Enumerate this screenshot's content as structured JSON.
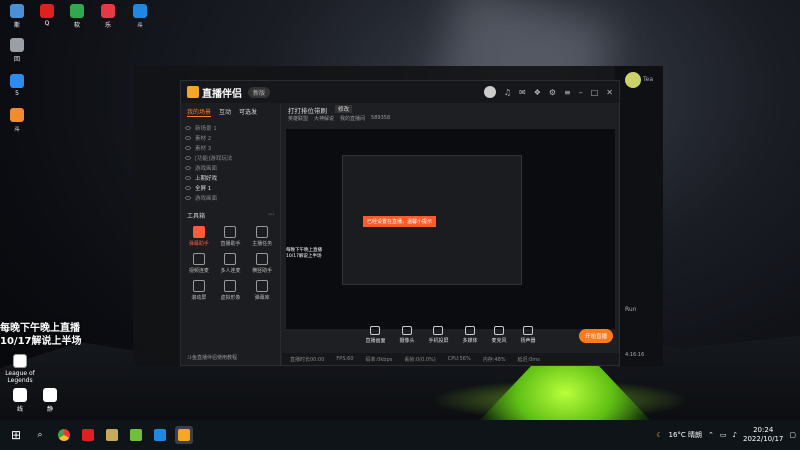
{
  "desktop": {
    "icons": [
      {
        "label": "斯",
        "color": "#4a90d9"
      },
      {
        "label": "Q",
        "color": "#e02020"
      },
      {
        "label": "软",
        "color": "#2fa84f"
      },
      {
        "label": "乐",
        "color": "#e63946"
      },
      {
        "label": "斗",
        "color": "#1e88e5"
      },
      {
        "label": "回",
        "color": "#9aa0a6"
      },
      {
        "label": "5",
        "color": "#2d8cf0"
      },
      {
        "label": "斗",
        "color": "#f08c2d"
      }
    ],
    "notice_text": "每晚下午晚上直播\n10/17解说上半场",
    "lol_label": "League of Legends",
    "bottom_icons": [
      "线",
      "静"
    ]
  },
  "backwin": {
    "right_labels": [
      "Tea",
      "Run"
    ]
  },
  "app": {
    "logo": "直播伴侣",
    "version": "新版",
    "tabs": [
      "我的场景",
      "互动",
      "可选发"
    ],
    "scenes": [
      {
        "label": "新场景 1",
        "on": false
      },
      {
        "label": "素材 2",
        "on": false
      },
      {
        "label": "素材 3",
        "on": false
      },
      {
        "label": "[功能]游戏玩法",
        "on": false
      },
      {
        "label": "游戏画面",
        "on": false
      },
      {
        "label": "上期好戏",
        "on": true
      },
      {
        "label": "全屏 1",
        "on": true
      },
      {
        "label": "游戏画面",
        "on": false
      }
    ],
    "tools_title": "工具箱",
    "tools": [
      {
        "label": "弹幕助手",
        "hot": true
      },
      {
        "label": "直播助手",
        "hot": false
      },
      {
        "label": "主播任务",
        "hot": false
      },
      {
        "label": "视频连麦",
        "hot": false
      },
      {
        "label": "多人连麦",
        "hot": false
      },
      {
        "label": "横竖助手",
        "hot": false
      },
      {
        "label": "滚动屏",
        "hot": false
      },
      {
        "label": "虚拟形象",
        "hot": false
      },
      {
        "label": "弹幕库",
        "hot": false
      }
    ],
    "bottom_notice": "斗鱼直播伴侣使用教程",
    "stream_title": "打打排位带刷",
    "stream_mod": "修改",
    "stream_meta": [
      "英雄联盟",
      "大神解说",
      "我的直播间",
      "589358"
    ],
    "toast": "已经设置在直播，温馨小提示",
    "preview_side_text": "每晚下午晚上直播\n10/17解说上半场",
    "bottom_tools": [
      "直播画面",
      "摄像头",
      "手机投屏",
      "多媒体",
      "麦克风",
      "扬声器"
    ],
    "go_live": "开始直播",
    "status": [
      "直播时长00:00",
      "FPS:60",
      "码率:0kbps",
      "丢帧:0(0.0%)",
      "CPU:56%",
      "内存:48%",
      "延迟:0ms"
    ],
    "zoom": "4:16:16"
  },
  "taskbar": {
    "weather": "16°C 晴朗",
    "time": "20:24",
    "date": "2022/10/17"
  }
}
